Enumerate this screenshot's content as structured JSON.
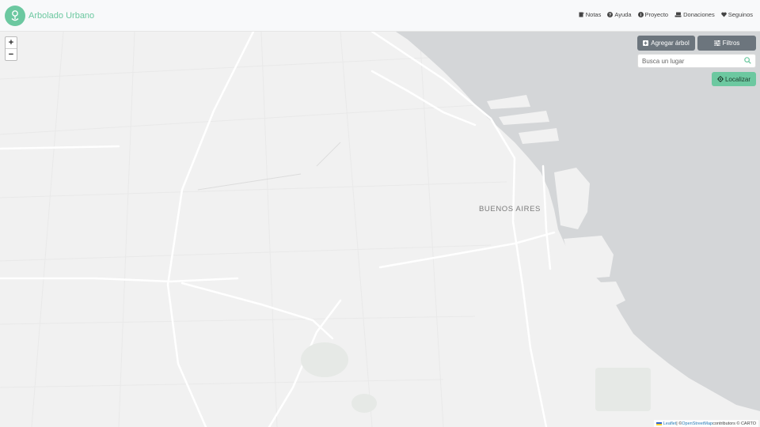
{
  "brand": {
    "title": "Arbolado Urbano",
    "accent": "#6cc8a0"
  },
  "nav": [
    {
      "label": "Notas",
      "icon": "notes-icon"
    },
    {
      "label": "Ayuda",
      "icon": "question-icon"
    },
    {
      "label": "Proyecto",
      "icon": "info-icon"
    },
    {
      "label": "Donaciones",
      "icon": "donate-icon"
    },
    {
      "label": "Seguinos",
      "icon": "heart-icon"
    }
  ],
  "map": {
    "city_label": "BUENOS AIRES",
    "zoom_in": "+",
    "zoom_out": "−",
    "water_color": "#d4d6d8",
    "land_color": "#f1f1f1"
  },
  "controls": {
    "add_tree": "Agregar árbol",
    "filters": "Filtros",
    "search_placeholder": "Busca un lugar",
    "locate": "Localizar"
  },
  "attribution": {
    "leaflet": "Leaflet",
    "sep1": " | © ",
    "osm": "OpenStreetMap",
    "rest": " contributors © CARTO"
  }
}
